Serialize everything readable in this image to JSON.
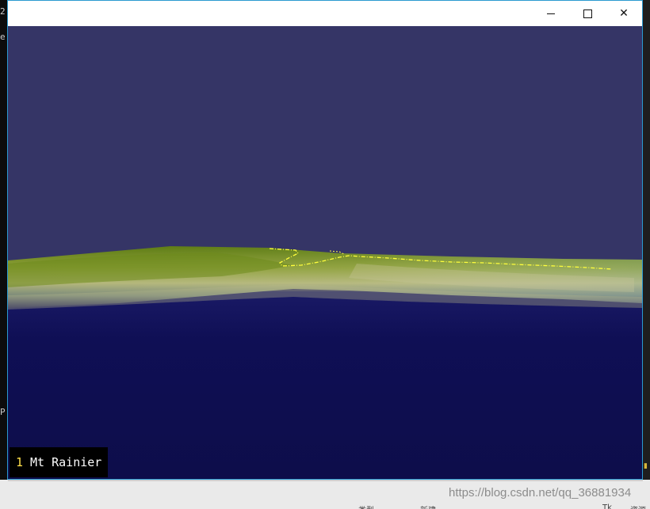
{
  "background": {
    "console_chars": [
      "2",
      "e",
      "P"
    ],
    "taskbar_fragments": [
      "类型",
      "新建",
      "Tk",
      "资源"
    ]
  },
  "window": {
    "controls": {
      "minimize": "minimize-icon",
      "maximize": "maximize-icon",
      "close": "close-icon",
      "close_glyph": "✕"
    },
    "viewport": {
      "scene": "3D terrain render",
      "sky_color": "#353566",
      "ground_color": "#0e0e4e",
      "terrain_color": "#7d9a2a",
      "trail_color": "#ffff3c"
    },
    "overlay_label": {
      "number": "1",
      "name": "Mt Rainier"
    }
  },
  "watermark": "https://blog.csdn.net/qq_36881934"
}
